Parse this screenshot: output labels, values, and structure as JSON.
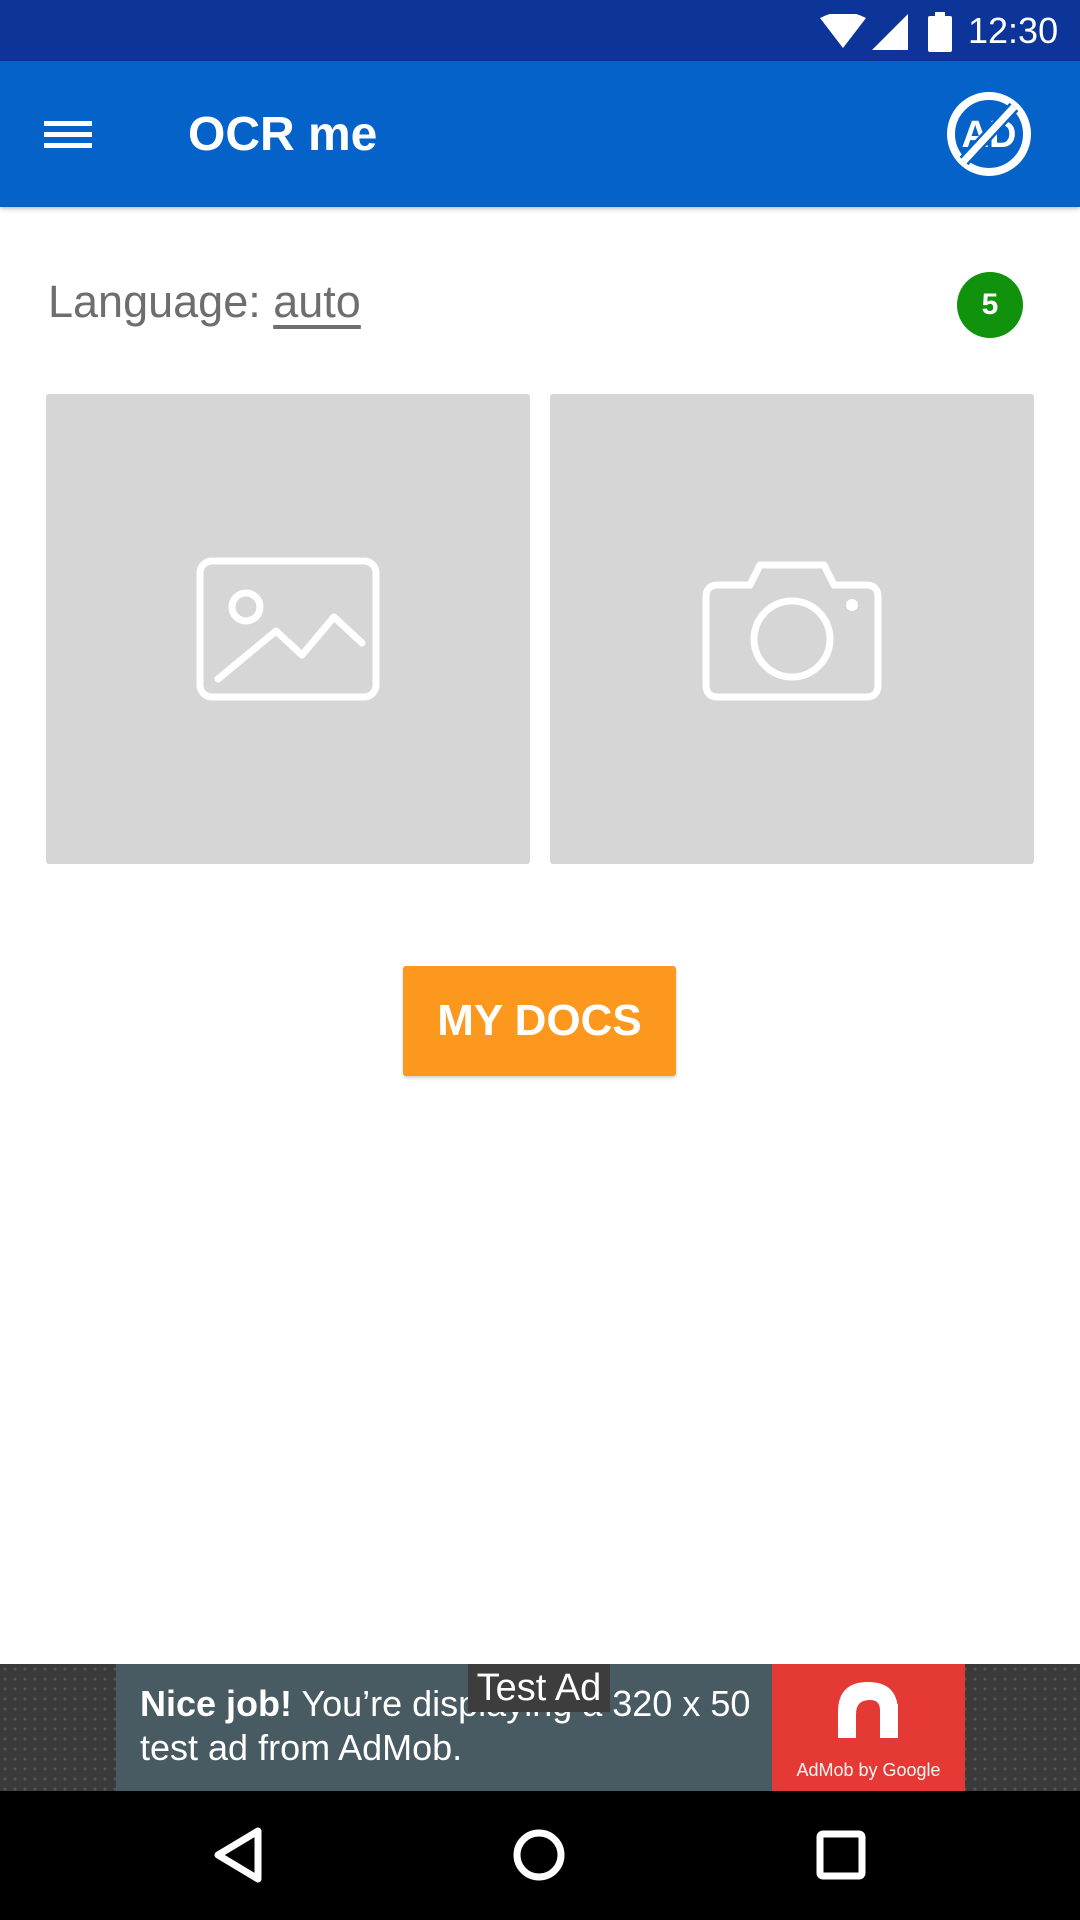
{
  "status_bar": {
    "time": "12:30",
    "icons": [
      "wifi-icon",
      "signal-icon",
      "battery-icon"
    ]
  },
  "app_bar": {
    "title": "OCR me",
    "menu_icon": "hamburger-menu-icon",
    "no_ads_icon": "no-ads-icon",
    "no_ads_label": "AD"
  },
  "language": {
    "label": "Language:",
    "value": "auto"
  },
  "badge": {
    "count": "5"
  },
  "tiles": [
    {
      "icon": "image-gallery-icon"
    },
    {
      "icon": "camera-icon"
    }
  ],
  "my_docs_button": {
    "label": "MY DOCS"
  },
  "ad": {
    "label": "Test Ad",
    "headline": "Nice job!",
    "text": "You’re displaying a 320 x 50 test ad from AdMob.",
    "brand": "AdMob by Google"
  },
  "nav_bar": {
    "icons": [
      "back-icon",
      "home-icon",
      "recents-icon"
    ]
  },
  "colors": {
    "status_bar": "#0d3498",
    "app_bar": "#0562c8",
    "badge": "#11920c",
    "tile": "#d6d6d6",
    "button": "#fd981e",
    "ad_body": "#485a62",
    "ad_logo": "#e53935"
  }
}
